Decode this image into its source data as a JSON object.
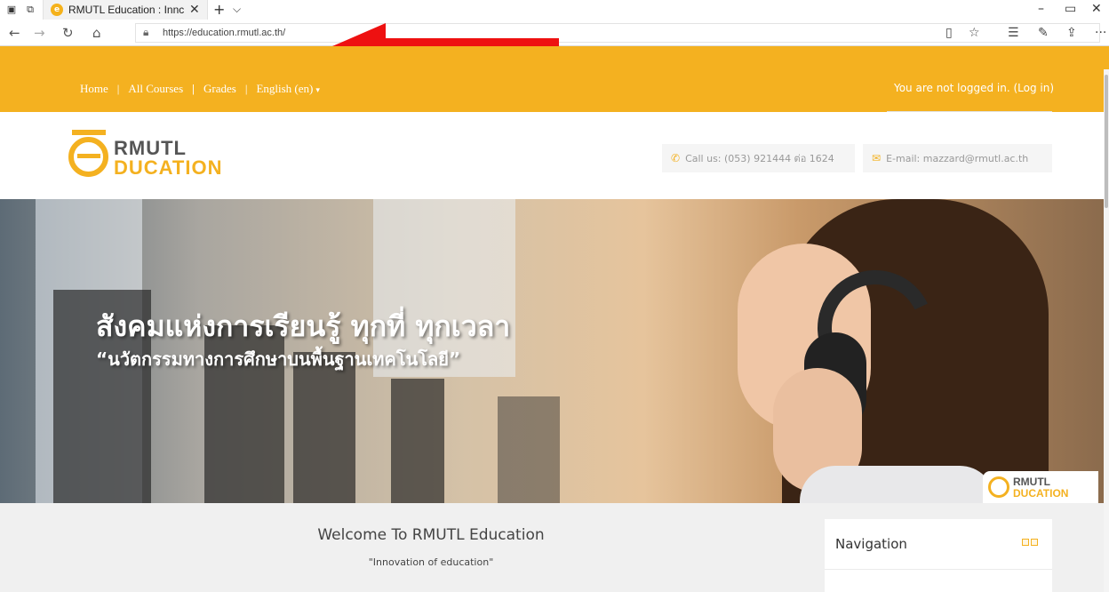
{
  "browser": {
    "tab_title": "RMUTL Education : Innc",
    "tab_close": "✕",
    "new_tab": "+",
    "tab_list": "⌵",
    "url": "https://education.rmutl.ac.th/",
    "window_controls": [
      "–",
      "▭",
      "✕"
    ],
    "icons": [
      "tab-preview-icon",
      "tab-aside-icon",
      "back-icon",
      "forward-icon",
      "refresh-icon",
      "home-icon",
      "lock-icon",
      "reading-view-icon",
      "favorite-icon",
      "favorites-hub-icon",
      "notes-icon",
      "share-icon",
      "more-icon"
    ],
    "more": "···"
  },
  "annotation": {
    "arrow_color": "#ee1111"
  },
  "site_nav": {
    "items": [
      "Home",
      "All Courses",
      "Grades",
      "English (en)"
    ],
    "separators": [
      "|",
      "|",
      "|"
    ],
    "language_caret": "▾",
    "login_text": "You are not logged in. (Log in)",
    "accent_color": "#f4b120"
  },
  "header": {
    "logo_top": "RMUTL",
    "logo_bottom": "DUCATION",
    "phone": "Call us: (053) 921444 ต่อ 1624",
    "email": "E-mail: mazzard@rmutl.ac.th"
  },
  "banner": {
    "title": "สังคมแห่งการเรียนรู้ ทุกที่ ทุกเวลา",
    "subtitle": "“นวัตกรรมทางการศึกษาบนพื้นฐานเทคโนโลยี”",
    "logo_top": "RMUTL",
    "logo_bottom": "DUCATION"
  },
  "main": {
    "welcome": "Welcome To RMUTL Education",
    "tagline": "\"Innovation of education\""
  },
  "navigation_block": {
    "title": "Navigation"
  }
}
